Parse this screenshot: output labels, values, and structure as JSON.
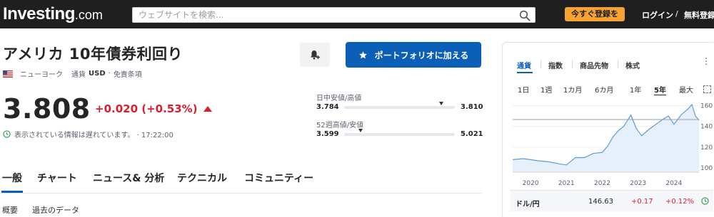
{
  "header": {
    "logo_main": "Investing",
    "logo_domain": ".com",
    "search_placeholder": "ウェブサイトを検索...",
    "signup_label": "今すぐ登録を",
    "login_label": "ログイン",
    "separator": "/",
    "free_signup_label": "無料登録"
  },
  "instrument": {
    "title": "アメリカ 10年債券利回り",
    "exchange": "ニューヨーク",
    "currency_label": "通貨",
    "currency": "USD",
    "dot": "·",
    "tax_note": "免責条項",
    "price": "3.808",
    "change": "+0.020 (+0.53%)",
    "delay_note": "表示されている情報は遅れています。 · 17:22:00",
    "portfolio_button": "ポートフォリオに加える"
  },
  "ranges": {
    "day_label": "日中安値/高値",
    "day_low": "3.784",
    "day_high": "3.810",
    "day_position": 0.88,
    "week52_label": "52週高値/安値",
    "week52_low": "3.599",
    "week52_high": "5.021",
    "week52_position": 0.15
  },
  "tabs": [
    "一般",
    "チャート",
    "ニュース& 分析",
    "テクニカル",
    "コミュニティー"
  ],
  "subtabs": [
    "概要",
    "過去のデータ"
  ],
  "panel": {
    "asset_tabs": [
      "通貨",
      "指数",
      "商品先物",
      "株式"
    ],
    "more_icon": "⋮",
    "time_ranges": [
      "1日",
      "1週",
      "1カ月",
      "6カ月",
      "1年",
      "5年",
      "最大"
    ],
    "active_range": "5年",
    "pair": {
      "name": "ドル/円",
      "value": "146.63",
      "change": "+0.17",
      "change_pct": "+0.12%"
    }
  },
  "colors": {
    "topbar": "#1f1f1f",
    "accent_blue": "#0b5fb6",
    "signup_orange": "#f7a334",
    "negative_red": "#d91e2e"
  },
  "chart_data": {
    "type": "area",
    "x_tick_labels": [
      "2020",
      "2021",
      "2022",
      "2023",
      "2024"
    ],
    "y_tick_labels": [
      "160",
      "140",
      "120",
      "100"
    ],
    "ylim": [
      96,
      163
    ],
    "reference_line": 146.63,
    "grid": true,
    "x": [
      2019.5,
      2019.8,
      2020.0,
      2020.2,
      2020.5,
      2020.8,
      2021.0,
      2021.25,
      2021.5,
      2021.75,
      2022.0,
      2022.15,
      2022.3,
      2022.45,
      2022.6,
      2022.8,
      2022.95,
      2023.1,
      2023.3,
      2023.5,
      2023.7,
      2023.85,
      2024.0,
      2024.2,
      2024.4,
      2024.5,
      2024.6,
      2024.7
    ],
    "y": [
      108,
      109,
      108,
      107,
      106,
      104,
      103,
      110,
      110,
      114,
      115,
      121,
      130,
      136,
      140,
      151,
      138,
      131,
      137,
      142,
      147,
      150,
      142,
      151,
      157,
      161,
      150,
      146
    ]
  }
}
